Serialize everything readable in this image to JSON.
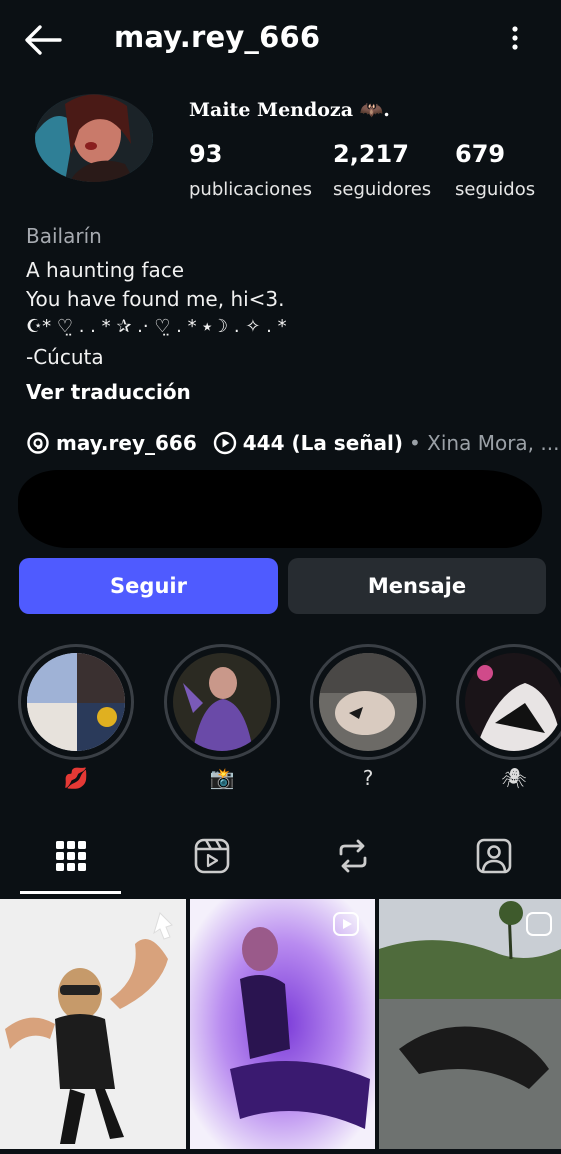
{
  "header": {
    "username": "may.rey_666",
    "back_icon": "arrow-left-icon",
    "more_icon": "more-vertical-icon"
  },
  "profile": {
    "full_name": "Maite Mendoza 🦇.",
    "stats": [
      {
        "value": "93",
        "label": "publicaciones"
      },
      {
        "value": "2,217",
        "label": "seguidores"
      },
      {
        "value": "679",
        "label": "seguidos"
      }
    ],
    "category": "Bailarín",
    "bio_lines": [
      "A haunting face",
      "You have found me, hi<3.",
      "☪︎* ♡̤ . . * ✰ .· ♡̤ . * ⭑☽ . ✧ . *",
      "-Cúcuta"
    ],
    "translate_label": "Ver traducción",
    "threads_handle": "may.rey_666",
    "music": {
      "title": "444 (La señal)",
      "artist": "• Xina Mora, ..."
    }
  },
  "actions": {
    "follow_label": "Seguir",
    "message_label": "Mensaje"
  },
  "highlights": [
    {
      "label": "💋"
    },
    {
      "label": "📸"
    },
    {
      "label": "?"
    },
    {
      "label": "🕷"
    }
  ],
  "colors": {
    "background": "#0b1014",
    "primary_button": "#4f5bff",
    "secondary_button": "#272c31"
  }
}
